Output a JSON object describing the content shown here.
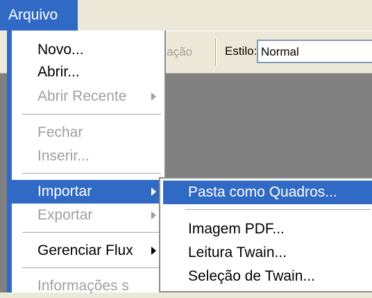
{
  "menubar": {
    "active_menu": "Arquivo"
  },
  "toolbar": {
    "ghost_text": "ização",
    "style_label": "Estilo:",
    "style_value": "Normal"
  },
  "file_menu": {
    "items": [
      {
        "label": "Novo..."
      },
      {
        "label": "Abrir..."
      },
      {
        "label": "Abrir Recente"
      },
      {
        "label": "Fechar"
      },
      {
        "label": "Inserir..."
      },
      {
        "label": "Importar"
      },
      {
        "label": "Exportar"
      },
      {
        "label": "Gerenciar Flux"
      },
      {
        "label": "Informações s"
      }
    ]
  },
  "import_submenu": {
    "items": [
      {
        "label": "Pasta como Quadros..."
      },
      {
        "label": "Imagem PDF..."
      },
      {
        "label": "Leitura Twain..."
      },
      {
        "label": "Seleção de Twain..."
      }
    ]
  },
  "colors": {
    "highlight": "#316ac5",
    "disabled_text": "#a0a0a0",
    "canvas": "#808080",
    "chrome": "#ece9d8"
  }
}
